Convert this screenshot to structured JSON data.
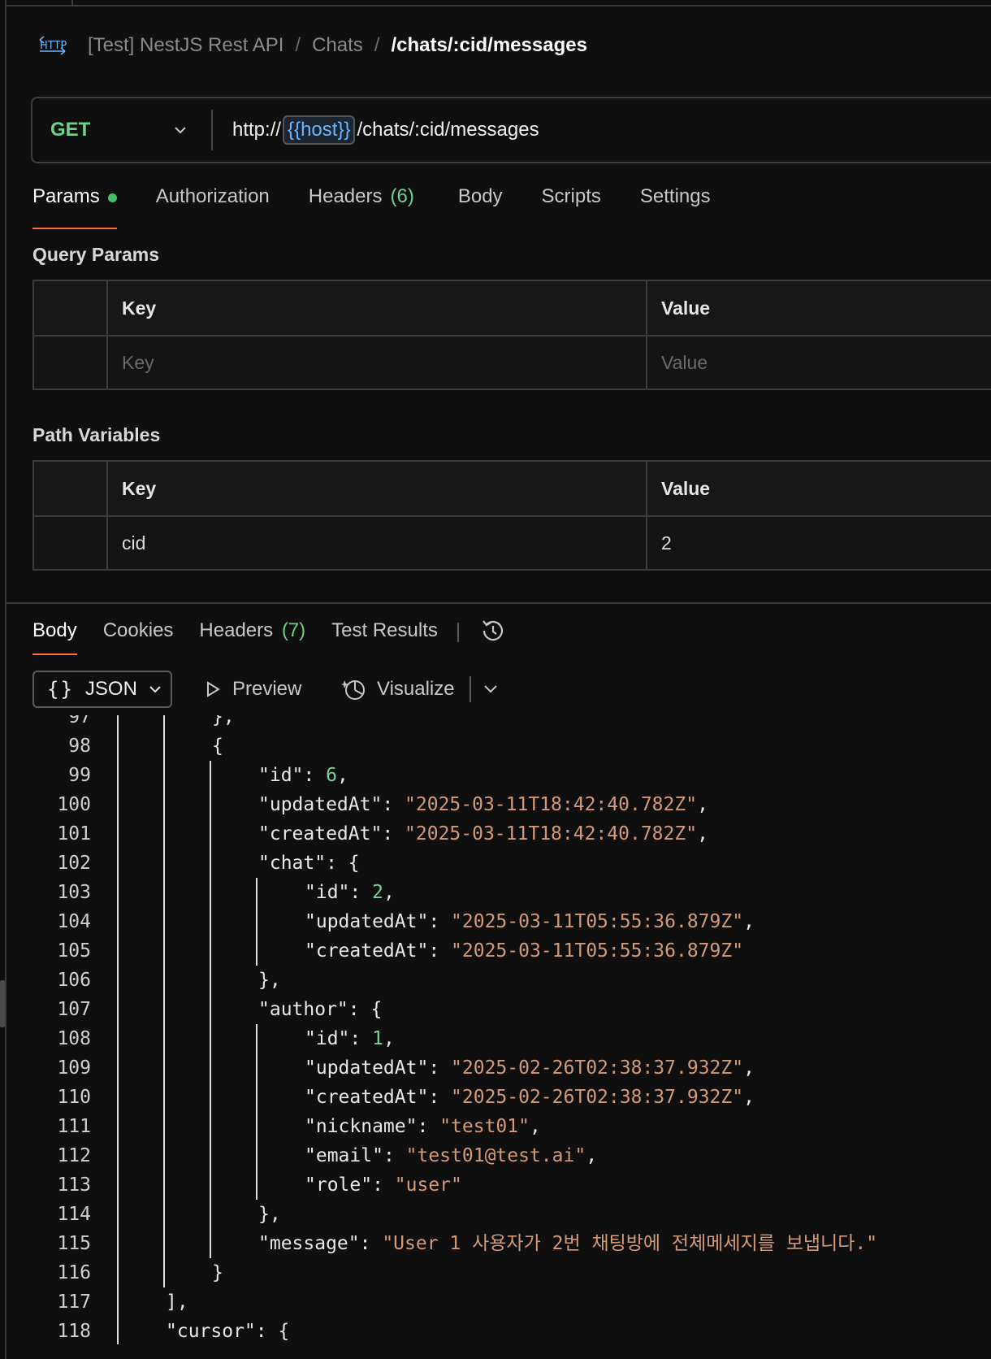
{
  "breadcrumb": {
    "icon": "http-icon",
    "collection": "[Test] NestJS Rest API",
    "folder": "Chats",
    "request": "/chats/:cid/messages",
    "separator": "/"
  },
  "request": {
    "method": "GET",
    "url_prefix": "http://",
    "url_variable": "{{host}}",
    "url_suffix": "/chats/:cid/messages"
  },
  "request_tabs": [
    {
      "label": "Params",
      "active": true
    },
    {
      "label": "Authorization"
    },
    {
      "label": "Headers",
      "count": "(6)"
    },
    {
      "label": "Body"
    },
    {
      "label": "Scripts"
    },
    {
      "label": "Settings"
    }
  ],
  "query_params": {
    "title": "Query Params",
    "key_header": "Key",
    "value_header": "Value",
    "key_placeholder": "Key",
    "value_placeholder": "Value"
  },
  "path_variables": {
    "title": "Path Variables",
    "key_header": "Key",
    "value_header": "Value",
    "rows": [
      {
        "key": "cid",
        "value": "2"
      }
    ]
  },
  "response_tabs": [
    {
      "label": "Body",
      "active": true
    },
    {
      "label": "Cookies"
    },
    {
      "label": "Headers",
      "count": "(7)"
    },
    {
      "label": "Test Results"
    }
  ],
  "response_toolbar": {
    "format_braces": "{}",
    "format": "JSON",
    "preview": "Preview",
    "visualize": "Visualize"
  },
  "code_lines": [
    {
      "n": "97",
      "depth": 3,
      "parts": [
        [
          "p",
          "},"
        ]
      ]
    },
    {
      "n": "98",
      "depth": 3,
      "parts": [
        [
          "p",
          "{"
        ]
      ]
    },
    {
      "n": "99",
      "depth": 4,
      "parts": [
        [
          "k",
          "\"id\""
        ],
        [
          "p",
          ": "
        ],
        [
          "n",
          "6"
        ],
        [
          "p",
          ","
        ]
      ]
    },
    {
      "n": "100",
      "depth": 4,
      "parts": [
        [
          "k",
          "\"updatedAt\""
        ],
        [
          "p",
          ": "
        ],
        [
          "s",
          "\"2025-03-11T18:42:40.782Z\""
        ],
        [
          "p",
          ","
        ]
      ]
    },
    {
      "n": "101",
      "depth": 4,
      "parts": [
        [
          "k",
          "\"createdAt\""
        ],
        [
          "p",
          ": "
        ],
        [
          "s",
          "\"2025-03-11T18:42:40.782Z\""
        ],
        [
          "p",
          ","
        ]
      ]
    },
    {
      "n": "102",
      "depth": 4,
      "parts": [
        [
          "k",
          "\"chat\""
        ],
        [
          "p",
          ": {"
        ]
      ]
    },
    {
      "n": "103",
      "depth": 5,
      "parts": [
        [
          "k",
          "\"id\""
        ],
        [
          "p",
          ": "
        ],
        [
          "n",
          "2"
        ],
        [
          "p",
          ","
        ]
      ]
    },
    {
      "n": "104",
      "depth": 5,
      "parts": [
        [
          "k",
          "\"updatedAt\""
        ],
        [
          "p",
          ": "
        ],
        [
          "s",
          "\"2025-03-11T05:55:36.879Z\""
        ],
        [
          "p",
          ","
        ]
      ]
    },
    {
      "n": "105",
      "depth": 5,
      "parts": [
        [
          "k",
          "\"createdAt\""
        ],
        [
          "p",
          ": "
        ],
        [
          "s",
          "\"2025-03-11T05:55:36.879Z\""
        ]
      ]
    },
    {
      "n": "106",
      "depth": 4,
      "parts": [
        [
          "p",
          "},"
        ]
      ]
    },
    {
      "n": "107",
      "depth": 4,
      "parts": [
        [
          "k",
          "\"author\""
        ],
        [
          "p",
          ": {"
        ]
      ]
    },
    {
      "n": "108",
      "depth": 5,
      "parts": [
        [
          "k",
          "\"id\""
        ],
        [
          "p",
          ": "
        ],
        [
          "n",
          "1"
        ],
        [
          "p",
          ","
        ]
      ]
    },
    {
      "n": "109",
      "depth": 5,
      "parts": [
        [
          "k",
          "\"updatedAt\""
        ],
        [
          "p",
          ": "
        ],
        [
          "s",
          "\"2025-02-26T02:38:37.932Z\""
        ],
        [
          "p",
          ","
        ]
      ]
    },
    {
      "n": "110",
      "depth": 5,
      "parts": [
        [
          "k",
          "\"createdAt\""
        ],
        [
          "p",
          ": "
        ],
        [
          "s",
          "\"2025-02-26T02:38:37.932Z\""
        ],
        [
          "p",
          ","
        ]
      ]
    },
    {
      "n": "111",
      "depth": 5,
      "parts": [
        [
          "k",
          "\"nickname\""
        ],
        [
          "p",
          ": "
        ],
        [
          "s",
          "\"test01\""
        ],
        [
          "p",
          ","
        ]
      ]
    },
    {
      "n": "112",
      "depth": 5,
      "parts": [
        [
          "k",
          "\"email\""
        ],
        [
          "p",
          ": "
        ],
        [
          "s",
          "\"test01@test.ai\""
        ],
        [
          "p",
          ","
        ]
      ]
    },
    {
      "n": "113",
      "depth": 5,
      "parts": [
        [
          "k",
          "\"role\""
        ],
        [
          "p",
          ": "
        ],
        [
          "s",
          "\"user\""
        ]
      ]
    },
    {
      "n": "114",
      "depth": 4,
      "parts": [
        [
          "p",
          "},"
        ]
      ]
    },
    {
      "n": "115",
      "depth": 4,
      "parts": [
        [
          "k",
          "\"message\""
        ],
        [
          "p",
          ": "
        ],
        [
          "s",
          "\"User 1 사용자가 2번 채팅방에 전체메세지를 보냅니다.\""
        ]
      ]
    },
    {
      "n": "116",
      "depth": 3,
      "parts": [
        [
          "p",
          "}"
        ]
      ]
    },
    {
      "n": "117",
      "depth": 2,
      "parts": [
        [
          "p",
          "],"
        ]
      ]
    },
    {
      "n": "118",
      "depth": 2,
      "parts": [
        [
          "k",
          "\"cursor\""
        ],
        [
          "p",
          ": {"
        ]
      ]
    }
  ],
  "colors": {
    "accent": "#ff6c37",
    "method_get": "#6fd089",
    "variable": "#6ab7ff",
    "json_string": "#d49a78",
    "json_number": "#7fcf9a"
  }
}
